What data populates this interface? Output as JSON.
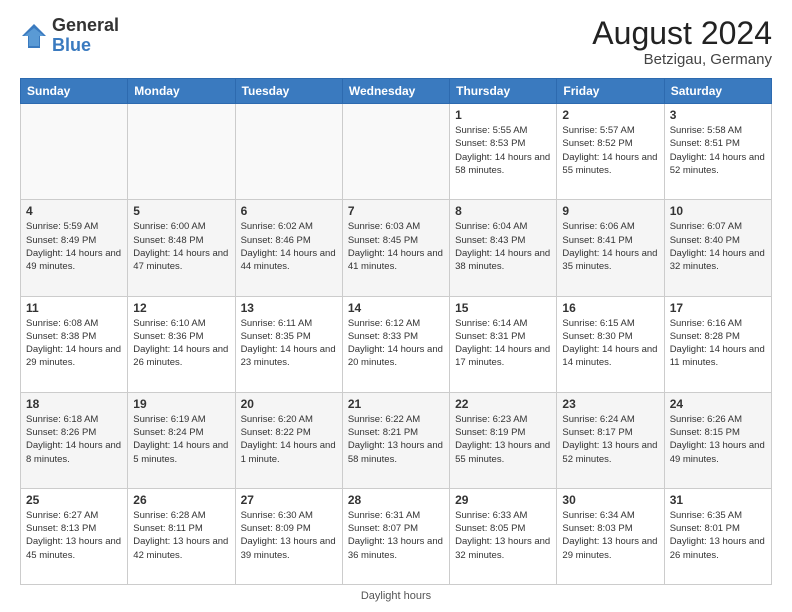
{
  "header": {
    "logo_general": "General",
    "logo_blue": "Blue",
    "month_year": "August 2024",
    "location": "Betzigau, Germany"
  },
  "footer": {
    "note": "Daylight hours"
  },
  "days_of_week": [
    "Sunday",
    "Monday",
    "Tuesday",
    "Wednesday",
    "Thursday",
    "Friday",
    "Saturday"
  ],
  "weeks": [
    [
      {
        "day": "",
        "empty": true
      },
      {
        "day": "",
        "empty": true
      },
      {
        "day": "",
        "empty": true
      },
      {
        "day": "",
        "empty": true
      },
      {
        "day": "1",
        "sunrise": "Sunrise: 5:55 AM",
        "sunset": "Sunset: 8:53 PM",
        "daylight": "Daylight: 14 hours and 58 minutes."
      },
      {
        "day": "2",
        "sunrise": "Sunrise: 5:57 AM",
        "sunset": "Sunset: 8:52 PM",
        "daylight": "Daylight: 14 hours and 55 minutes."
      },
      {
        "day": "3",
        "sunrise": "Sunrise: 5:58 AM",
        "sunset": "Sunset: 8:51 PM",
        "daylight": "Daylight: 14 hours and 52 minutes."
      }
    ],
    [
      {
        "day": "4",
        "sunrise": "Sunrise: 5:59 AM",
        "sunset": "Sunset: 8:49 PM",
        "daylight": "Daylight: 14 hours and 49 minutes."
      },
      {
        "day": "5",
        "sunrise": "Sunrise: 6:00 AM",
        "sunset": "Sunset: 8:48 PM",
        "daylight": "Daylight: 14 hours and 47 minutes."
      },
      {
        "day": "6",
        "sunrise": "Sunrise: 6:02 AM",
        "sunset": "Sunset: 8:46 PM",
        "daylight": "Daylight: 14 hours and 44 minutes."
      },
      {
        "day": "7",
        "sunrise": "Sunrise: 6:03 AM",
        "sunset": "Sunset: 8:45 PM",
        "daylight": "Daylight: 14 hours and 41 minutes."
      },
      {
        "day": "8",
        "sunrise": "Sunrise: 6:04 AM",
        "sunset": "Sunset: 8:43 PM",
        "daylight": "Daylight: 14 hours and 38 minutes."
      },
      {
        "day": "9",
        "sunrise": "Sunrise: 6:06 AM",
        "sunset": "Sunset: 8:41 PM",
        "daylight": "Daylight: 14 hours and 35 minutes."
      },
      {
        "day": "10",
        "sunrise": "Sunrise: 6:07 AM",
        "sunset": "Sunset: 8:40 PM",
        "daylight": "Daylight: 14 hours and 32 minutes."
      }
    ],
    [
      {
        "day": "11",
        "sunrise": "Sunrise: 6:08 AM",
        "sunset": "Sunset: 8:38 PM",
        "daylight": "Daylight: 14 hours and 29 minutes."
      },
      {
        "day": "12",
        "sunrise": "Sunrise: 6:10 AM",
        "sunset": "Sunset: 8:36 PM",
        "daylight": "Daylight: 14 hours and 26 minutes."
      },
      {
        "day": "13",
        "sunrise": "Sunrise: 6:11 AM",
        "sunset": "Sunset: 8:35 PM",
        "daylight": "Daylight: 14 hours and 23 minutes."
      },
      {
        "day": "14",
        "sunrise": "Sunrise: 6:12 AM",
        "sunset": "Sunset: 8:33 PM",
        "daylight": "Daylight: 14 hours and 20 minutes."
      },
      {
        "day": "15",
        "sunrise": "Sunrise: 6:14 AM",
        "sunset": "Sunset: 8:31 PM",
        "daylight": "Daylight: 14 hours and 17 minutes."
      },
      {
        "day": "16",
        "sunrise": "Sunrise: 6:15 AM",
        "sunset": "Sunset: 8:30 PM",
        "daylight": "Daylight: 14 hours and 14 minutes."
      },
      {
        "day": "17",
        "sunrise": "Sunrise: 6:16 AM",
        "sunset": "Sunset: 8:28 PM",
        "daylight": "Daylight: 14 hours and 11 minutes."
      }
    ],
    [
      {
        "day": "18",
        "sunrise": "Sunrise: 6:18 AM",
        "sunset": "Sunset: 8:26 PM",
        "daylight": "Daylight: 14 hours and 8 minutes."
      },
      {
        "day": "19",
        "sunrise": "Sunrise: 6:19 AM",
        "sunset": "Sunset: 8:24 PM",
        "daylight": "Daylight: 14 hours and 5 minutes."
      },
      {
        "day": "20",
        "sunrise": "Sunrise: 6:20 AM",
        "sunset": "Sunset: 8:22 PM",
        "daylight": "Daylight: 14 hours and 1 minute."
      },
      {
        "day": "21",
        "sunrise": "Sunrise: 6:22 AM",
        "sunset": "Sunset: 8:21 PM",
        "daylight": "Daylight: 13 hours and 58 minutes."
      },
      {
        "day": "22",
        "sunrise": "Sunrise: 6:23 AM",
        "sunset": "Sunset: 8:19 PM",
        "daylight": "Daylight: 13 hours and 55 minutes."
      },
      {
        "day": "23",
        "sunrise": "Sunrise: 6:24 AM",
        "sunset": "Sunset: 8:17 PM",
        "daylight": "Daylight: 13 hours and 52 minutes."
      },
      {
        "day": "24",
        "sunrise": "Sunrise: 6:26 AM",
        "sunset": "Sunset: 8:15 PM",
        "daylight": "Daylight: 13 hours and 49 minutes."
      }
    ],
    [
      {
        "day": "25",
        "sunrise": "Sunrise: 6:27 AM",
        "sunset": "Sunset: 8:13 PM",
        "daylight": "Daylight: 13 hours and 45 minutes."
      },
      {
        "day": "26",
        "sunrise": "Sunrise: 6:28 AM",
        "sunset": "Sunset: 8:11 PM",
        "daylight": "Daylight: 13 hours and 42 minutes."
      },
      {
        "day": "27",
        "sunrise": "Sunrise: 6:30 AM",
        "sunset": "Sunset: 8:09 PM",
        "daylight": "Daylight: 13 hours and 39 minutes."
      },
      {
        "day": "28",
        "sunrise": "Sunrise: 6:31 AM",
        "sunset": "Sunset: 8:07 PM",
        "daylight": "Daylight: 13 hours and 36 minutes."
      },
      {
        "day": "29",
        "sunrise": "Sunrise: 6:33 AM",
        "sunset": "Sunset: 8:05 PM",
        "daylight": "Daylight: 13 hours and 32 minutes."
      },
      {
        "day": "30",
        "sunrise": "Sunrise: 6:34 AM",
        "sunset": "Sunset: 8:03 PM",
        "daylight": "Daylight: 13 hours and 29 minutes."
      },
      {
        "day": "31",
        "sunrise": "Sunrise: 6:35 AM",
        "sunset": "Sunset: 8:01 PM",
        "daylight": "Daylight: 13 hours and 26 minutes."
      }
    ]
  ]
}
